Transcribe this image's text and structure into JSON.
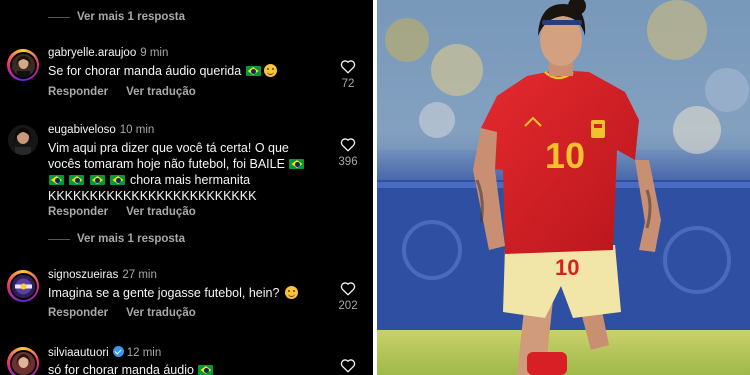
{
  "top_view_more": "Ver mais 1 resposta",
  "middle_view_more": "Ver mais 1 resposta",
  "comments": [
    {
      "username": "gabryelle.araujoo",
      "time": "9 min",
      "text": "Se for chorar manda áudio querida",
      "reply": "Responder",
      "translate": "Ver tradução",
      "likes": "72"
    },
    {
      "username": "eugabiveloso",
      "time": "10 min",
      "text_line1": "Vim aqui pra dizer que você tá certa! O que",
      "text_line2": "vocês tomaram hoje não futebol, foi BAILE",
      "text_line3": "chora mais hermanita",
      "text_line4": "KKKKKKKKKKKKKKKKKKKKKKKKK",
      "reply": "Responder",
      "translate": "Ver tradução",
      "likes": "396"
    },
    {
      "username": "signoszueiras",
      "time": "27 min",
      "text": "Imagina se a gente jogasse futebol, hein?",
      "reply": "Responder",
      "translate": "Ver tradução",
      "likes": "202"
    },
    {
      "username": "silviaautuori",
      "time": "12 min",
      "text": "só for chorar manda áudio"
    }
  ],
  "photo": {
    "jersey_number": "10",
    "colors": {
      "jersey": "#d81f26",
      "number": "#f2c12e",
      "shorts": "#f1e6a8"
    }
  },
  "colors": {
    "background": "#000000",
    "primary_text": "#f5f5f5",
    "secondary_text": "#a8a8a8"
  }
}
